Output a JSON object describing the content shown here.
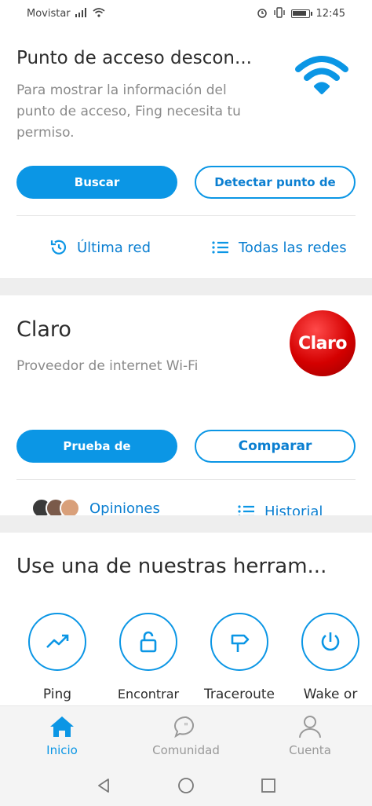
{
  "status_bar": {
    "carrier": "Movistar",
    "time": "12:45",
    "battery_level": 0.9
  },
  "hotspot_card": {
    "title": "Punto de acceso descon...",
    "description": "Para mostrar la información del punto de acceso, Fing necesita tu permiso.",
    "search_button": "Buscar",
    "detect_button": "Detectar punto de",
    "last_network_link": "Última red",
    "all_networks_link": "Todas las redes",
    "icon": "wifi-icon"
  },
  "isp_card": {
    "title": "Claro",
    "description": "Proveedor de internet Wi-Fi",
    "logo_text": "Claro",
    "speed_test_button": "Prueba de",
    "compare_button": "Comparar",
    "reviews_link": "Opiniones",
    "history_link": "Historial"
  },
  "tools_card": {
    "title": "Use una de nuestras herram...",
    "tools": [
      {
        "label": "Ping",
        "icon": "trend-icon"
      },
      {
        "label": "Encontrar",
        "icon": "lock-icon"
      },
      {
        "label": "Traceroute",
        "icon": "signpost-icon"
      },
      {
        "label": "Wake or",
        "icon": "power-icon"
      }
    ]
  },
  "bottom_nav": {
    "items": [
      {
        "label": "Inicio",
        "icon": "home-icon",
        "active": true
      },
      {
        "label": "Comunidad",
        "icon": "chat-icon",
        "active": false
      },
      {
        "label": "Cuenta",
        "icon": "user-icon",
        "active": false
      }
    ]
  },
  "colors": {
    "accent": "#0b96e5",
    "brand_red": "#d40000"
  }
}
